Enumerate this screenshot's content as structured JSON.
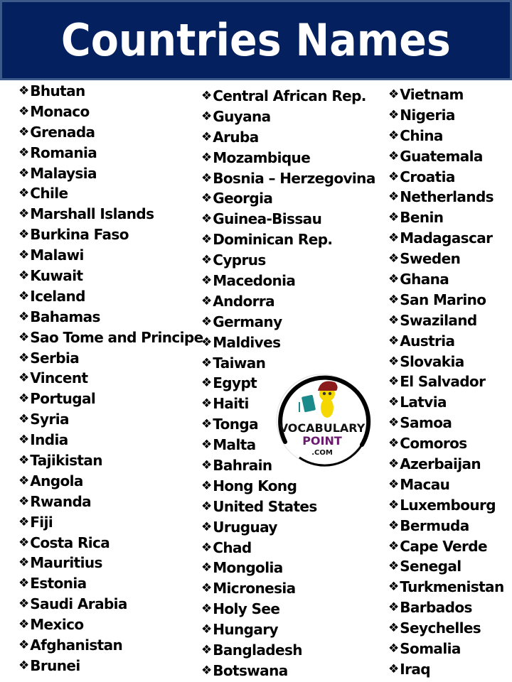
{
  "header": {
    "title": "Countries Names"
  },
  "bullet_glyph": "❖",
  "columns": [
    [
      "Bhutan",
      "Monaco",
      "Grenada",
      "Romania",
      "Malaysia",
      "Chile",
      "Marshall Islands",
      "Burkina Faso",
      "Malawi",
      "Kuwait",
      "Iceland",
      "Bahamas",
      "Sao Tome and Principe",
      "Serbia",
      "Vincent",
      "Portugal",
      "Syria",
      "India",
      "Tajikistan",
      "Angola",
      "Rwanda",
      "Fiji",
      "Costa Rica",
      "Mauritius",
      "Estonia",
      "Saudi Arabia",
      "Mexico",
      "Afghanistan",
      "Brunei"
    ],
    [
      "Central African Rep.",
      "Guyana",
      "Aruba",
      "Mozambique",
      "Bosnia – Herzegovina",
      "Georgia",
      "Guinea-Bissau",
      "Dominican Rep.",
      "Cyprus",
      "Macedonia",
      "Andorra",
      "Germany",
      "Maldives",
      "Taiwan",
      "Egypt",
      "Haiti",
      "Tonga",
      "Malta",
      "Bahrain",
      "Hong Kong",
      "United States",
      "Uruguay",
      "Chad",
      "Mongolia",
      "Micronesia",
      "Holy See",
      "Hungary",
      "Bangladesh",
      "Botswana"
    ],
    [
      "Vietnam",
      "Nigeria",
      "China",
      "Guatemala",
      "Croatia",
      "Netherlands",
      "Benin",
      "Madagascar",
      "Sweden",
      "Ghana",
      "San Marino",
      "Swaziland",
      "Austria",
      "Slovakia",
      "El Salvador",
      "Latvia",
      "Samoa",
      "Comoros",
      "Azerbaijan",
      "Macau",
      "Luxembourg",
      "Bermuda",
      "Cape Verde",
      "Senegal",
      "Turkmenistan",
      "Barbados",
      "Seychelles",
      "Somalia",
      "Iraq"
    ]
  ],
  "logo": {
    "line1": "VOCABULARY",
    "line2": "POINT",
    "line3": ".COM"
  },
  "colors": {
    "header_bg": "#04205e",
    "header_border": "#3d5a8a",
    "logo_purple": "#6a1b6e",
    "logo_hat": "#8b1a1a",
    "logo_face": "#f5d800",
    "logo_book": "#1a8a8a"
  }
}
